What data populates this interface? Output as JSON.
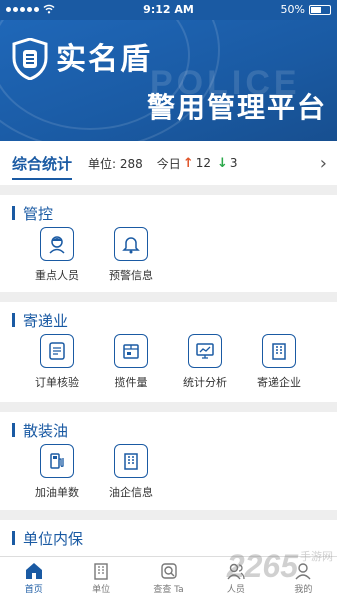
{
  "status_bar": {
    "time": "9:12 AM",
    "battery": "50%"
  },
  "header": {
    "brand": "实名盾",
    "watermark": "POLICE",
    "platform_title": "警用管理平台"
  },
  "summary": {
    "title": "综合统计",
    "unit_label": "单位:",
    "unit_count": "288",
    "today_label": "今日",
    "up_count": "12",
    "down_count": "3"
  },
  "sections": [
    {
      "title": "管控",
      "items": [
        {
          "label": "重点人员",
          "icon": "person-icon"
        },
        {
          "label": "预警信息",
          "icon": "bell-icon"
        }
      ]
    },
    {
      "title": "寄递业",
      "items": [
        {
          "label": "订单核验",
          "icon": "order-verify-icon"
        },
        {
          "label": "揽件量",
          "icon": "package-icon"
        },
        {
          "label": "统计分析",
          "icon": "chart-monitor-icon"
        },
        {
          "label": "寄递企业",
          "icon": "building-icon"
        }
      ]
    },
    {
      "title": "散装油",
      "items": [
        {
          "label": "加油单数",
          "icon": "fuel-pump-icon"
        },
        {
          "label": "油企信息",
          "icon": "building-icon"
        }
      ]
    },
    {
      "title": "单位内保",
      "items": []
    }
  ],
  "tabbar": [
    {
      "label": "首页",
      "icon": "home-icon",
      "active": true
    },
    {
      "label": "单位",
      "icon": "building-icon",
      "active": false
    },
    {
      "label": "查查 Ta",
      "icon": "search-person-icon",
      "active": false
    },
    {
      "label": "人员",
      "icon": "people-icon",
      "active": false
    },
    {
      "label": "我的",
      "icon": "user-icon",
      "active": false
    }
  ],
  "watermark": {
    "text": "2265",
    "sub": "手游网"
  },
  "colors": {
    "primary": "#1a5aa3",
    "up": "#e0552a",
    "down": "#2aa84a"
  }
}
